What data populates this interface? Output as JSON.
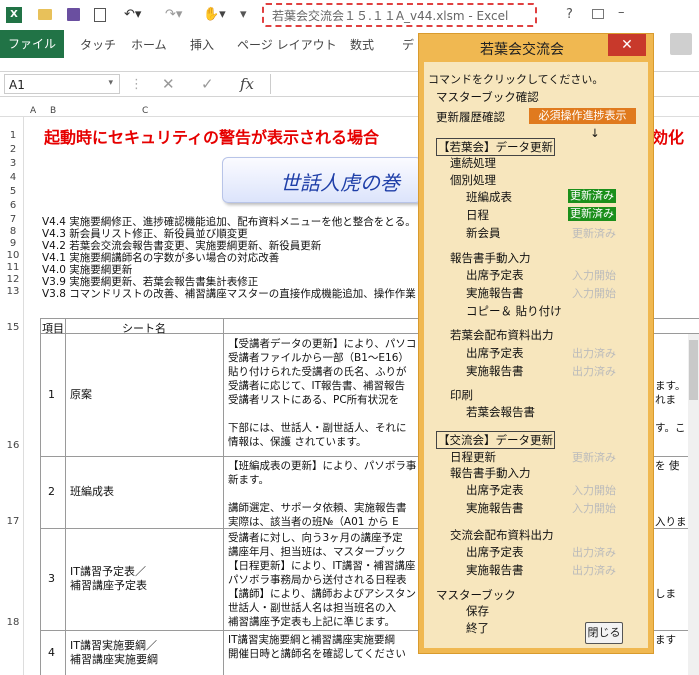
{
  "title": "若葉会交流会１５.１１A_v44.xlsm - Excel",
  "ribbon": {
    "file": "ファイル",
    "tabs": [
      "タッチ",
      "ホーム",
      "挿入",
      "ページ レイアウト",
      "数式",
      "デ"
    ]
  },
  "namebox": "A1",
  "col_headers": [
    "A",
    "B",
    "C"
  ],
  "row1_title": "起動時にセキュリティの警告が表示される場合",
  "row1_tail": "効化",
  "banner": "世話人虎の巻",
  "versions": [
    {
      "row": "7",
      "text": "V4.4  実施要綱修正、進捗確認機能追加、配布資料メニューを他と整合をとる。"
    },
    {
      "row": "8",
      "text": "V4.3  新会員リスト修正、新役員並び順変更"
    },
    {
      "row": "9",
      "text": "V4.2  若葉会交流会報告書変更、実施要綱更新、新役員更新"
    },
    {
      "row": "10",
      "text": "V4.1  実施要綱講師名の字数が多い場合の対応改善"
    },
    {
      "row": "11",
      "text": "V4.0  実施要綱更新"
    },
    {
      "row": "12",
      "text": "V3.9  実施要綱更新、若葉会報告書集計表修正"
    },
    {
      "row": "13",
      "text": "V3.8  コマンドリストの改善、補習講座マスターの直接作成機能追加、操作作業"
    }
  ],
  "sheet_table": {
    "header": [
      "項目",
      "シート名"
    ],
    "rows": [
      {
        "num": "1",
        "name": "原案",
        "desc": [
          "【受講者データの更新】により、パソコ",
          "受講者ファイルから一部（B1～E16）",
          "貼り付けられた受講者の氏名、ふりが",
          "受講者に応じて、IT報告書、補習報告",
          "受講者リストにある、PC所有状況を",
          "",
          "下部には、世話人・副世話人、それに",
          "情報は、保護 されています。"
        ],
        "tail": [
          "",
          "",
          "",
          "ます。",
          "れま",
          "",
          "す。こ",
          ""
        ]
      },
      {
        "num": "2",
        "name": "班編成表",
        "desc": [
          "【班編成表の更新】により、パソボラ事",
          "新ます。",
          "",
          "講師選定、サポータ依頼、実施報告書",
          "実際は、該当者の班№（A01 から E"
        ],
        "tail": [
          "を 使",
          "",
          "",
          "",
          "入りま"
        ]
      },
      {
        "num": "3",
        "name": "IT講習予定表／\n補習講座予定表",
        "desc": [
          "受講者に対し、向う3ヶ月の講座予定",
          "講座年月、担当班は、マスターブック",
          "【日程更新】により、IT講習・補習講座",
          "パソボラ事務局から送付される日程表",
          "【講師】により、講師およびアシスタン",
          "世話人・副世話人名は担当班名の入",
          "補習講座予定表も上記に準じます。"
        ],
        "tail": [
          "",
          "",
          "",
          "",
          "しま",
          "",
          ""
        ]
      },
      {
        "num": "4",
        "name": "IT講習実施要綱／\n補習講座実施要綱",
        "desc": [
          "IT講習実施要綱と補習講座実施要綱",
          "開催日時と講師名を確認してください"
        ],
        "tail": [
          "ます",
          ""
        ]
      }
    ]
  },
  "row_labels": [
    "15",
    "16",
    "17",
    "18"
  ],
  "dialog": {
    "title": "若葉会交流会",
    "prompt": "コマンドをクリックしてください。",
    "master_check": "マスターブック確認",
    "history": "更新履歴確認",
    "progress_btn": "必須操作進捗表示",
    "arrow": "↓",
    "sec1": "【若葉会】データ更新",
    "renzoku": "連続処理",
    "kobetsu": "個別処理",
    "items1": [
      {
        "label": "班編成表",
        "status": "更新済み",
        "done": true
      },
      {
        "label": "日程",
        "status": "更新済み",
        "done": true
      },
      {
        "label": "新会員",
        "status": "更新済み",
        "done": false
      }
    ],
    "report_manual": "報告書手動入力",
    "items2": [
      {
        "label": "出席予定表",
        "status": "入力開始"
      },
      {
        "label": "実施報告書",
        "status": "入力開始"
      },
      {
        "label": "コピー＆ 貼り付け",
        "status": ""
      }
    ],
    "wakaba_dist": "若葉会配布資料出力",
    "items3": [
      {
        "label": "出席予定表",
        "status": "出力済み"
      },
      {
        "label": "実施報告書",
        "status": "出力済み"
      }
    ],
    "print": "印刷",
    "print_item": "若葉会報告書",
    "sec2": "【交流会】データ更新",
    "nittei": "日程更新",
    "nittei_status": "更新済み",
    "report_manual2": "報告書手動入力",
    "items4": [
      {
        "label": "出席予定表",
        "status": "入力開始"
      },
      {
        "label": "実施報告書",
        "status": "入力開始"
      }
    ],
    "koryu_dist": "交流会配布資料出力",
    "items5": [
      {
        "label": "出席予定表",
        "status": "出力済み"
      },
      {
        "label": "実施報告書",
        "status": "出力済み"
      }
    ],
    "masterbook": "マスターブック",
    "save": "保存",
    "end": "終了",
    "close_btn": "閉じる"
  },
  "colors": {
    "excel_green": "#217346",
    "dialog_bg": "#f7e6bd",
    "dialog_frame": "#f0b851",
    "status_done": "#1b8f1b",
    "progress_bg": "#e07a1e",
    "title_red": "#e60000"
  }
}
